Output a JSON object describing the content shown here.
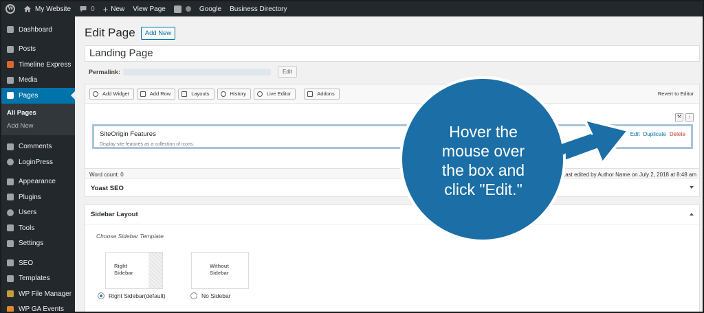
{
  "adminbar": {
    "site_name": "My Website",
    "comments_count": "0",
    "new_label": "New",
    "view_page_label": "View Page",
    "google_label": "Google",
    "business_directory_label": "Business Directory"
  },
  "sidebar": {
    "items": [
      {
        "label": "Dashboard",
        "icon": "dashboard-icon"
      },
      {
        "label": "Posts",
        "icon": "pin-icon"
      },
      {
        "label": "Timeline Express",
        "icon": "timeline-icon"
      },
      {
        "label": "Media",
        "icon": "media-icon"
      },
      {
        "label": "Pages",
        "icon": "page-icon"
      },
      {
        "label": "Comments",
        "icon": "comment-icon"
      },
      {
        "label": "LoginPress",
        "icon": "gear-icon"
      },
      {
        "label": "Appearance",
        "icon": "brush-icon"
      },
      {
        "label": "Plugins",
        "icon": "plug-icon"
      },
      {
        "label": "Users",
        "icon": "user-icon"
      },
      {
        "label": "Tools",
        "icon": "wrench-icon"
      },
      {
        "label": "Settings",
        "icon": "settings-icon"
      },
      {
        "label": "SEO",
        "icon": "yoast-icon"
      },
      {
        "label": "Templates",
        "icon": "template-icon"
      },
      {
        "label": "WP File Manager",
        "icon": "folder-icon"
      },
      {
        "label": "WP GA Events",
        "icon": "chart-icon"
      }
    ],
    "submenu": {
      "all_pages": "All Pages",
      "add_new": "Add New"
    }
  },
  "main": {
    "page_heading": "Edit Page",
    "add_new_label": "Add New",
    "title_value": "Landing Page",
    "permalink_label": "Permalink:",
    "permalink_edit": "Edit"
  },
  "builder": {
    "toolbar": {
      "add_widget": "Add Widget",
      "add_row": "Add Row",
      "layouts": "Layouts",
      "history": "History",
      "live_editor": "Live Editor",
      "addons": "Addons",
      "revert": "Revert to Editor"
    },
    "widget": {
      "title": "SiteOrigin Features",
      "description": "Display site features as a collection of icons.",
      "edit": "Edit",
      "duplicate": "Duplicate",
      "delete": "Delete"
    },
    "word_count": "Word count: 0",
    "last_edited": "am. Last edited by Author Name on July 2, 2018 at 8:48 am"
  },
  "yoast": {
    "title": "Yoast SEO"
  },
  "sidebar_layout": {
    "title": "Sidebar Layout",
    "choose_label": "Choose Sidebar Template",
    "templates": [
      {
        "line1": "Right",
        "line2": "Sidebar",
        "radio_label": "Right Sidebar(default)",
        "checked": true
      },
      {
        "line1": "Without",
        "line2": "Sidebar",
        "radio_label": "No Sidebar",
        "checked": false
      }
    ]
  },
  "callout": {
    "line1": "Hover the",
    "line2": "mouse over",
    "line3": "the box and",
    "line4": "click \"Edit.\"",
    "fill_color": "#1b6fa6",
    "border_color": "#ffffff"
  },
  "colors": {
    "admin_bg": "#23282d",
    "accent": "#0073aa",
    "delete": "#c0392b"
  }
}
